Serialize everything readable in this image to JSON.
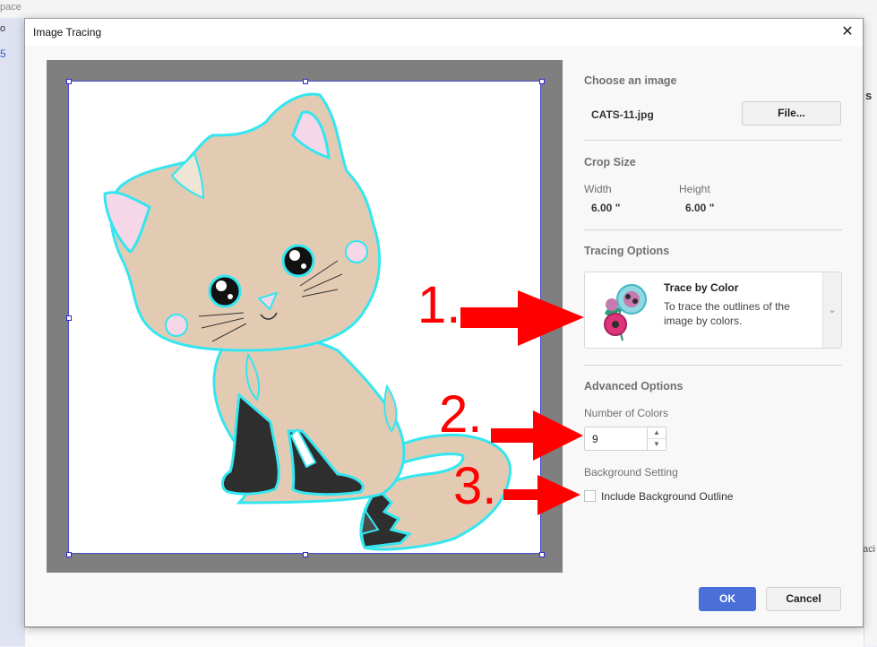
{
  "background": {
    "workspace_fragment": "pace",
    "left_fragment": "o",
    "tool_fragment": "5",
    "right_fragment": "s",
    "right_lower_fragment": "aci"
  },
  "dialog": {
    "title": "Image Tracing",
    "close_label": "✕"
  },
  "choose_image": {
    "title": "Choose an image",
    "filename": "CATS-11.jpg",
    "file_button": "File..."
  },
  "crop_size": {
    "title": "Crop Size",
    "width_label": "Width",
    "width_value": "6.00 \"",
    "height_label": "Height",
    "height_value": "6.00 \""
  },
  "tracing_options": {
    "title": "Tracing Options",
    "selected_name": "Trace by Color",
    "selected_description": "To trace the outlines of the image by colors.",
    "chevron_icon": "chevron-down-icon"
  },
  "advanced_options": {
    "title": "Advanced Options",
    "colors_label": "Number of Colors",
    "colors_value": "9",
    "background_title": "Background Setting",
    "background_checkbox_label": "Include Background Outline",
    "background_checked": false
  },
  "footer": {
    "ok_label": "OK",
    "cancel_label": "Cancel"
  },
  "annotations": [
    {
      "label": "1."
    },
    {
      "label": "2."
    },
    {
      "label": "3."
    }
  ],
  "colors": {
    "accent": "#4a6fd8",
    "annotation": "#ff0000",
    "trace_outline": "#33e6f0",
    "cat_fur": "#e3cbb3",
    "cat_dark": "#2e2e2e",
    "ear_pink": "#f6d7e8"
  }
}
